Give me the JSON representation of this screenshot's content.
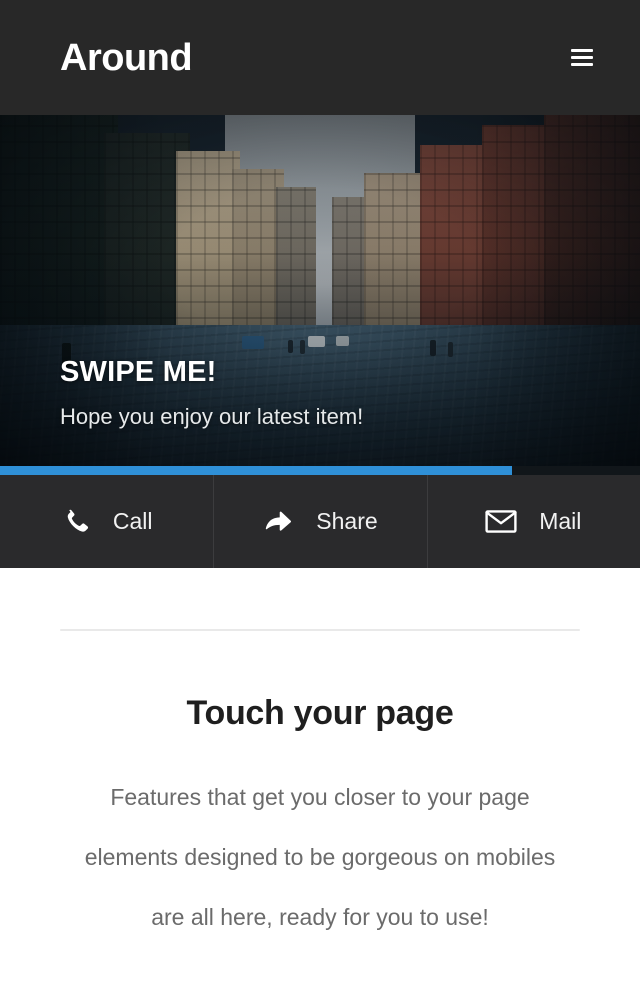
{
  "header": {
    "brand": "Around",
    "menu_icon": "hamburger-menu-icon"
  },
  "hero": {
    "title": "SWIPE ME!",
    "subtitle": "Hope you enjoy our latest item!",
    "image_description": "city street with buildings and fire escapes",
    "progress_percent": 80,
    "progress_color": "#2f90d8",
    "progress_track_color": "#11161a"
  },
  "actions": [
    {
      "icon": "phone-icon",
      "label": "Call"
    },
    {
      "icon": "share-arrow-icon",
      "label": "Share"
    },
    {
      "icon": "envelope-icon",
      "label": "Mail"
    }
  ],
  "content": {
    "title": "Touch your page",
    "body": "Features that get you closer to your page elements designed to be gorgeous on mobiles are all here, ready for you to use!"
  },
  "colors": {
    "header_background": "#282828",
    "action_bar_background": "#2a2a2c",
    "accent": "#2f90d8",
    "heading": "#1f1f1f",
    "body_text": "#6b6b6b",
    "divider": "#e9e9e9"
  }
}
